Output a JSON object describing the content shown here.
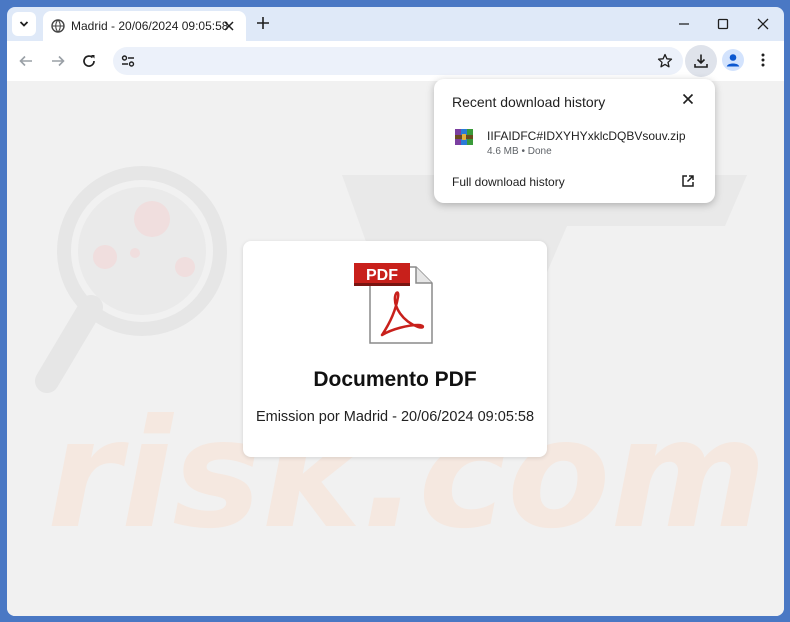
{
  "browser": {
    "tab": {
      "title": "Madrid - 20/06/2024 09:05:58"
    },
    "address_bar": {
      "value": ""
    }
  },
  "page": {
    "card": {
      "icon_label": "PDF",
      "title": "Documento PDF",
      "subtitle": "Emission por Madrid - 20/06/2024 09:05:58"
    },
    "watermark_text": "risk.com"
  },
  "downloads_popup": {
    "header": "Recent download history",
    "items": [
      {
        "filename": "IIFAIDFC#IDXYHYxklcDQBVsouv.zip",
        "meta": "4.6 MB • Done"
      }
    ],
    "full_history_label": "Full download history"
  },
  "colors": {
    "frame": "#dfe9f8",
    "accent": "#0b57d0",
    "pdf_red": "#c8201b"
  }
}
